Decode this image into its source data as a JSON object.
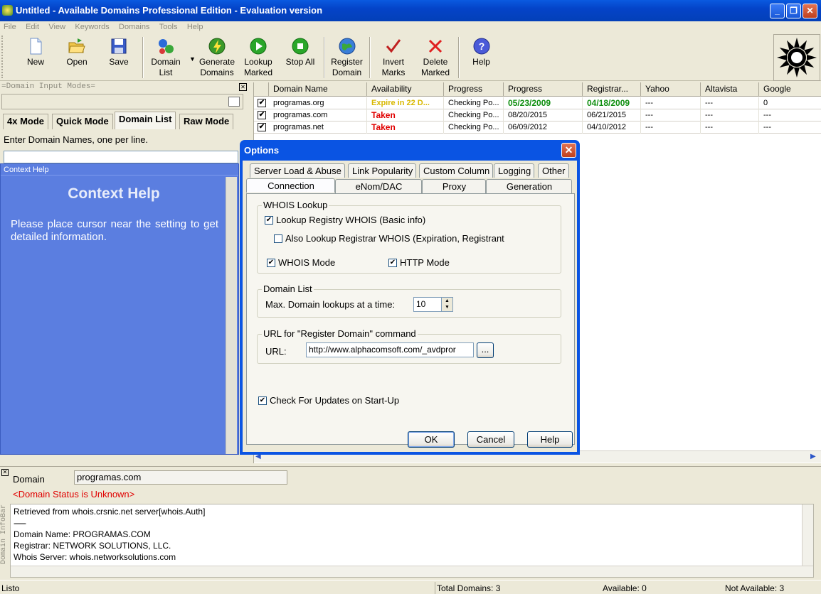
{
  "window": {
    "title": "Untitled - Available Domains Professional Edition - Evaluation version"
  },
  "menu": [
    "File",
    "Edit",
    "View",
    "Keywords",
    "Domains",
    "Tools",
    "Help"
  ],
  "toolbar": {
    "new": "New",
    "open": "Open",
    "save": "Save",
    "domain_list": "Domain\nList",
    "generate_domains": "Generate\nDomains",
    "lookup_marked": "Lookup\nMarked",
    "stop_all": "Stop All",
    "register_domain": "Register\nDomain",
    "invert_marks": "Invert\nMarks",
    "delete_marked": "Delete\nMarked",
    "help": "Help"
  },
  "left_panel": {
    "header": "=Domain Input Modes=",
    "tabs": [
      "4x Mode",
      "Quick Mode",
      "Domain List",
      "Raw Mode"
    ],
    "active_tab": "Domain List",
    "instruction": "Enter Domain Names, one per line."
  },
  "context_help": {
    "header": "Context Help",
    "title": "Context Help",
    "message": "Please place cursor near the setting to get detailed information."
  },
  "grid": {
    "columns": [
      "Domain Name",
      "Availability",
      "Progress",
      "Progress",
      "Registrar...",
      "Yahoo",
      "Altavista",
      "Google"
    ],
    "rows": [
      {
        "domain": "programas.org",
        "availability": "Expire in 22 D...",
        "progress1": "Checking Po...",
        "progress2": "05/23/2009",
        "registrar": "04/18/2009",
        "yahoo": "---",
        "altavista": "---",
        "google": "0"
      },
      {
        "domain": "programas.com",
        "availability": "Taken",
        "progress1": "Checking Po...",
        "progress2": "08/20/2015",
        "registrar": "06/21/2015",
        "yahoo": "---",
        "altavista": "---",
        "google": "---"
      },
      {
        "domain": "programas.net",
        "availability": "Taken",
        "progress1": "Checking Po...",
        "progress2": "06/09/2012",
        "registrar": "04/10/2012",
        "yahoo": "---",
        "altavista": "---",
        "google": "---"
      }
    ]
  },
  "infobar": {
    "vertical_label": "Domain InfoBar",
    "domain_label": "Domain",
    "domain_value": "programas.com",
    "status": "<Domain Status is Unknown>",
    "lines": [
      "Retrieved from whois.crsnic.net server[whois.Auth]",
      "--------",
      "Domain Name: PROGRAMAS.COM",
      "Registrar: NETWORK SOLUTIONS, LLC.",
      "Whois Server: whois.networksolutions.com"
    ]
  },
  "statusbar": {
    "state": "Listo",
    "total": "Total Domains: 3",
    "available": "Available: 0",
    "not_available": "Not Available: 3"
  },
  "dialog": {
    "title": "Options",
    "tabs_row1": [
      "Server Load & Abuse",
      "Link Popularity",
      "Custom Column",
      "Logging",
      "Other"
    ],
    "tabs_row2": [
      "Connection",
      "eNom/DAC",
      "Proxy",
      "Generation"
    ],
    "active_tab": "Connection",
    "whois": {
      "legend": "WHOIS Lookup",
      "registry_label": "Lookup Registry WHOIS (Basic info)",
      "registry_checked": true,
      "registrar_label": "Also Lookup Registrar WHOIS (Expiration, Registrant",
      "registrar_checked": false,
      "whois_mode_label": "WHOIS Mode",
      "whois_mode_checked": true,
      "http_mode_label": "HTTP Mode",
      "http_mode_checked": true
    },
    "domain_list": {
      "legend": "Domain List",
      "max_label": "Max. Domain lookups at a time:",
      "max_value": "10"
    },
    "url": {
      "legend": "URL for \"Register Domain\" command",
      "label": "URL:",
      "value": "http://www.alphacomsoft.com/_avdpror",
      "browse": "..."
    },
    "updates_label": "Check For Updates on Start-Up",
    "updates_checked": true,
    "ok": "OK",
    "cancel": "Cancel",
    "help": "Help"
  },
  "colors": {
    "title_blue": "#0443c8",
    "context_help_bg": "#5b7ee0",
    "taken_red": "#e00000",
    "expire_yellow": "#d8b800",
    "date_green": "#108f10"
  }
}
